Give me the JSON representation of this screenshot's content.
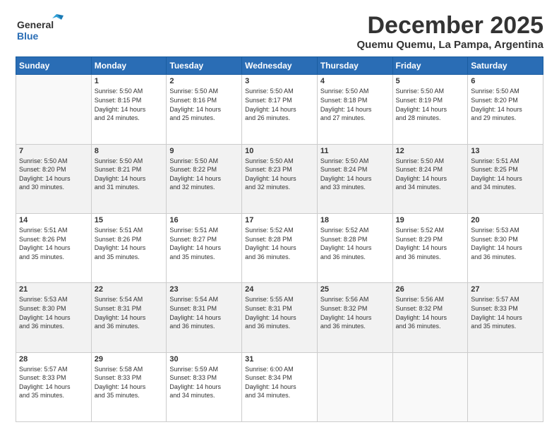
{
  "logo": {
    "general": "General",
    "blue": "Blue"
  },
  "title": "December 2025",
  "location": "Quemu Quemu, La Pampa, Argentina",
  "days_of_week": [
    "Sunday",
    "Monday",
    "Tuesday",
    "Wednesday",
    "Thursday",
    "Friday",
    "Saturday"
  ],
  "weeks": [
    [
      {
        "day": "",
        "content": ""
      },
      {
        "day": "1",
        "content": "Sunrise: 5:50 AM\nSunset: 8:15 PM\nDaylight: 14 hours\nand 24 minutes."
      },
      {
        "day": "2",
        "content": "Sunrise: 5:50 AM\nSunset: 8:16 PM\nDaylight: 14 hours\nand 25 minutes."
      },
      {
        "day": "3",
        "content": "Sunrise: 5:50 AM\nSunset: 8:17 PM\nDaylight: 14 hours\nand 26 minutes."
      },
      {
        "day": "4",
        "content": "Sunrise: 5:50 AM\nSunset: 8:18 PM\nDaylight: 14 hours\nand 27 minutes."
      },
      {
        "day": "5",
        "content": "Sunrise: 5:50 AM\nSunset: 8:19 PM\nDaylight: 14 hours\nand 28 minutes."
      },
      {
        "day": "6",
        "content": "Sunrise: 5:50 AM\nSunset: 8:20 PM\nDaylight: 14 hours\nand 29 minutes."
      }
    ],
    [
      {
        "day": "7",
        "content": "Sunrise: 5:50 AM\nSunset: 8:20 PM\nDaylight: 14 hours\nand 30 minutes."
      },
      {
        "day": "8",
        "content": "Sunrise: 5:50 AM\nSunset: 8:21 PM\nDaylight: 14 hours\nand 31 minutes."
      },
      {
        "day": "9",
        "content": "Sunrise: 5:50 AM\nSunset: 8:22 PM\nDaylight: 14 hours\nand 32 minutes."
      },
      {
        "day": "10",
        "content": "Sunrise: 5:50 AM\nSunset: 8:23 PM\nDaylight: 14 hours\nand 32 minutes."
      },
      {
        "day": "11",
        "content": "Sunrise: 5:50 AM\nSunset: 8:24 PM\nDaylight: 14 hours\nand 33 minutes."
      },
      {
        "day": "12",
        "content": "Sunrise: 5:50 AM\nSunset: 8:24 PM\nDaylight: 14 hours\nand 34 minutes."
      },
      {
        "day": "13",
        "content": "Sunrise: 5:51 AM\nSunset: 8:25 PM\nDaylight: 14 hours\nand 34 minutes."
      }
    ],
    [
      {
        "day": "14",
        "content": "Sunrise: 5:51 AM\nSunset: 8:26 PM\nDaylight: 14 hours\nand 35 minutes."
      },
      {
        "day": "15",
        "content": "Sunrise: 5:51 AM\nSunset: 8:26 PM\nDaylight: 14 hours\nand 35 minutes."
      },
      {
        "day": "16",
        "content": "Sunrise: 5:51 AM\nSunset: 8:27 PM\nDaylight: 14 hours\nand 35 minutes."
      },
      {
        "day": "17",
        "content": "Sunrise: 5:52 AM\nSunset: 8:28 PM\nDaylight: 14 hours\nand 36 minutes."
      },
      {
        "day": "18",
        "content": "Sunrise: 5:52 AM\nSunset: 8:28 PM\nDaylight: 14 hours\nand 36 minutes."
      },
      {
        "day": "19",
        "content": "Sunrise: 5:52 AM\nSunset: 8:29 PM\nDaylight: 14 hours\nand 36 minutes."
      },
      {
        "day": "20",
        "content": "Sunrise: 5:53 AM\nSunset: 8:30 PM\nDaylight: 14 hours\nand 36 minutes."
      }
    ],
    [
      {
        "day": "21",
        "content": "Sunrise: 5:53 AM\nSunset: 8:30 PM\nDaylight: 14 hours\nand 36 minutes."
      },
      {
        "day": "22",
        "content": "Sunrise: 5:54 AM\nSunset: 8:31 PM\nDaylight: 14 hours\nand 36 minutes."
      },
      {
        "day": "23",
        "content": "Sunrise: 5:54 AM\nSunset: 8:31 PM\nDaylight: 14 hours\nand 36 minutes."
      },
      {
        "day": "24",
        "content": "Sunrise: 5:55 AM\nSunset: 8:31 PM\nDaylight: 14 hours\nand 36 minutes."
      },
      {
        "day": "25",
        "content": "Sunrise: 5:56 AM\nSunset: 8:32 PM\nDaylight: 14 hours\nand 36 minutes."
      },
      {
        "day": "26",
        "content": "Sunrise: 5:56 AM\nSunset: 8:32 PM\nDaylight: 14 hours\nand 36 minutes."
      },
      {
        "day": "27",
        "content": "Sunrise: 5:57 AM\nSunset: 8:33 PM\nDaylight: 14 hours\nand 35 minutes."
      }
    ],
    [
      {
        "day": "28",
        "content": "Sunrise: 5:57 AM\nSunset: 8:33 PM\nDaylight: 14 hours\nand 35 minutes."
      },
      {
        "day": "29",
        "content": "Sunrise: 5:58 AM\nSunset: 8:33 PM\nDaylight: 14 hours\nand 35 minutes."
      },
      {
        "day": "30",
        "content": "Sunrise: 5:59 AM\nSunset: 8:33 PM\nDaylight: 14 hours\nand 34 minutes."
      },
      {
        "day": "31",
        "content": "Sunrise: 6:00 AM\nSunset: 8:34 PM\nDaylight: 14 hours\nand 34 minutes."
      },
      {
        "day": "",
        "content": ""
      },
      {
        "day": "",
        "content": ""
      },
      {
        "day": "",
        "content": ""
      }
    ]
  ],
  "accent_color": "#2a6db5"
}
